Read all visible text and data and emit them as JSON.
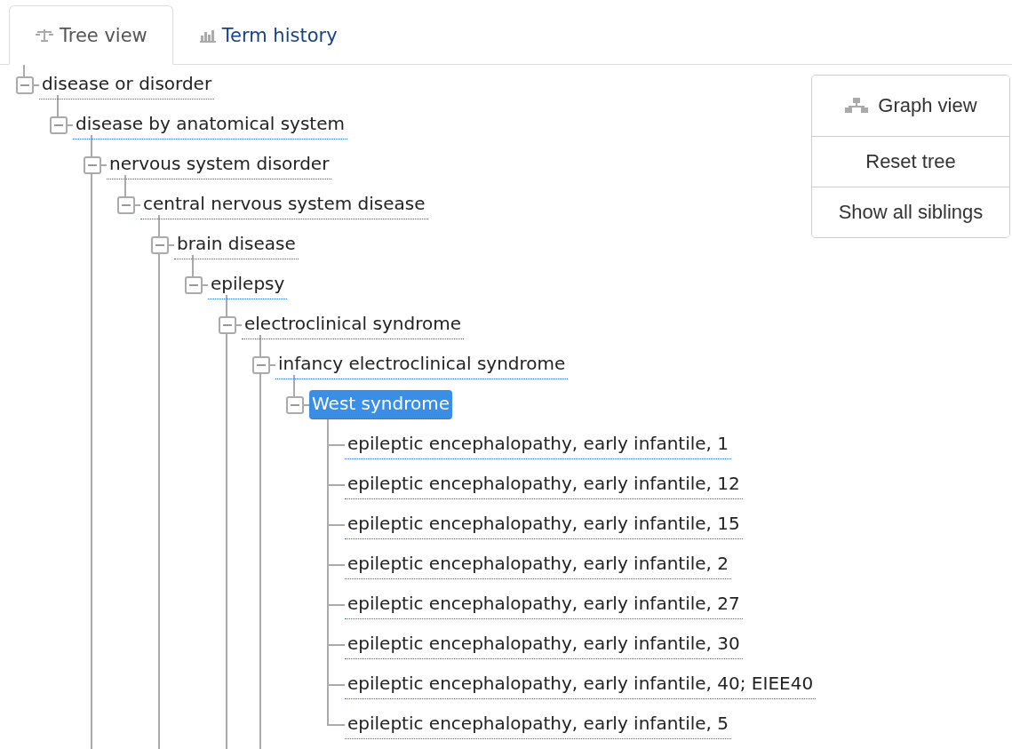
{
  "tabs": [
    {
      "label": "Tree view",
      "selected": true,
      "kind": "tree"
    },
    {
      "label": "Term history",
      "selected": false,
      "kind": "chart"
    }
  ],
  "tree": {
    "label": "disease or disorder",
    "expanded": true,
    "selected": false,
    "more_children": false,
    "children": [
      {
        "label": "disease by anatomical system",
        "expanded": true,
        "selected": false,
        "more_children": true,
        "children": [
          {
            "label": "nervous system disorder",
            "expanded": true,
            "selected": false,
            "more_children": false,
            "children": [
              {
                "label": "central nervous system disease",
                "expanded": true,
                "selected": false,
                "more_children": true,
                "children": [
                  {
                    "label": "brain disease",
                    "expanded": true,
                    "selected": false,
                    "more_children": false,
                    "children": [
                      {
                        "label": "epilepsy",
                        "expanded": true,
                        "selected": false,
                        "more_children": true,
                        "children": [
                          {
                            "label": "electroclinical syndrome",
                            "expanded": true,
                            "selected": false,
                            "more_children": true,
                            "children": [
                              {
                                "label": "infancy electroclinical syndrome",
                                "expanded": true,
                                "selected": false,
                                "more_children": false,
                                "children": [
                                  {
                                    "label": "West syndrome",
                                    "expanded": true,
                                    "selected": true,
                                    "more_children": false,
                                    "children": [
                                      {
                                        "label": "epileptic encephalopathy, early infantile, 1",
                                        "selected": false
                                      },
                                      {
                                        "label": "epileptic encephalopathy, early infantile, 12",
                                        "selected": false
                                      },
                                      {
                                        "label": "epileptic encephalopathy, early infantile, 15",
                                        "selected": false
                                      },
                                      {
                                        "label": "epileptic encephalopathy, early infantile, 2",
                                        "selected": false
                                      },
                                      {
                                        "label": "epileptic encephalopathy, early infantile, 27",
                                        "selected": false
                                      },
                                      {
                                        "label": "epileptic encephalopathy, early infantile, 30",
                                        "selected": false
                                      },
                                      {
                                        "label": "epileptic encephalopathy, early infantile, 40; EIEE40",
                                        "selected": false
                                      },
                                      {
                                        "label": "epileptic encephalopathy, early infantile, 5",
                                        "selected": false
                                      }
                                    ]
                                  }
                                ]
                              }
                            ]
                          }
                        ]
                      }
                    ]
                  }
                ]
              }
            ]
          }
        ]
      }
    ]
  },
  "actions": [
    {
      "label": "Graph view",
      "kind": "graph"
    },
    {
      "label": "Reset tree",
      "kind": "plain"
    },
    {
      "label": "Show all siblings",
      "kind": "plain"
    }
  ]
}
